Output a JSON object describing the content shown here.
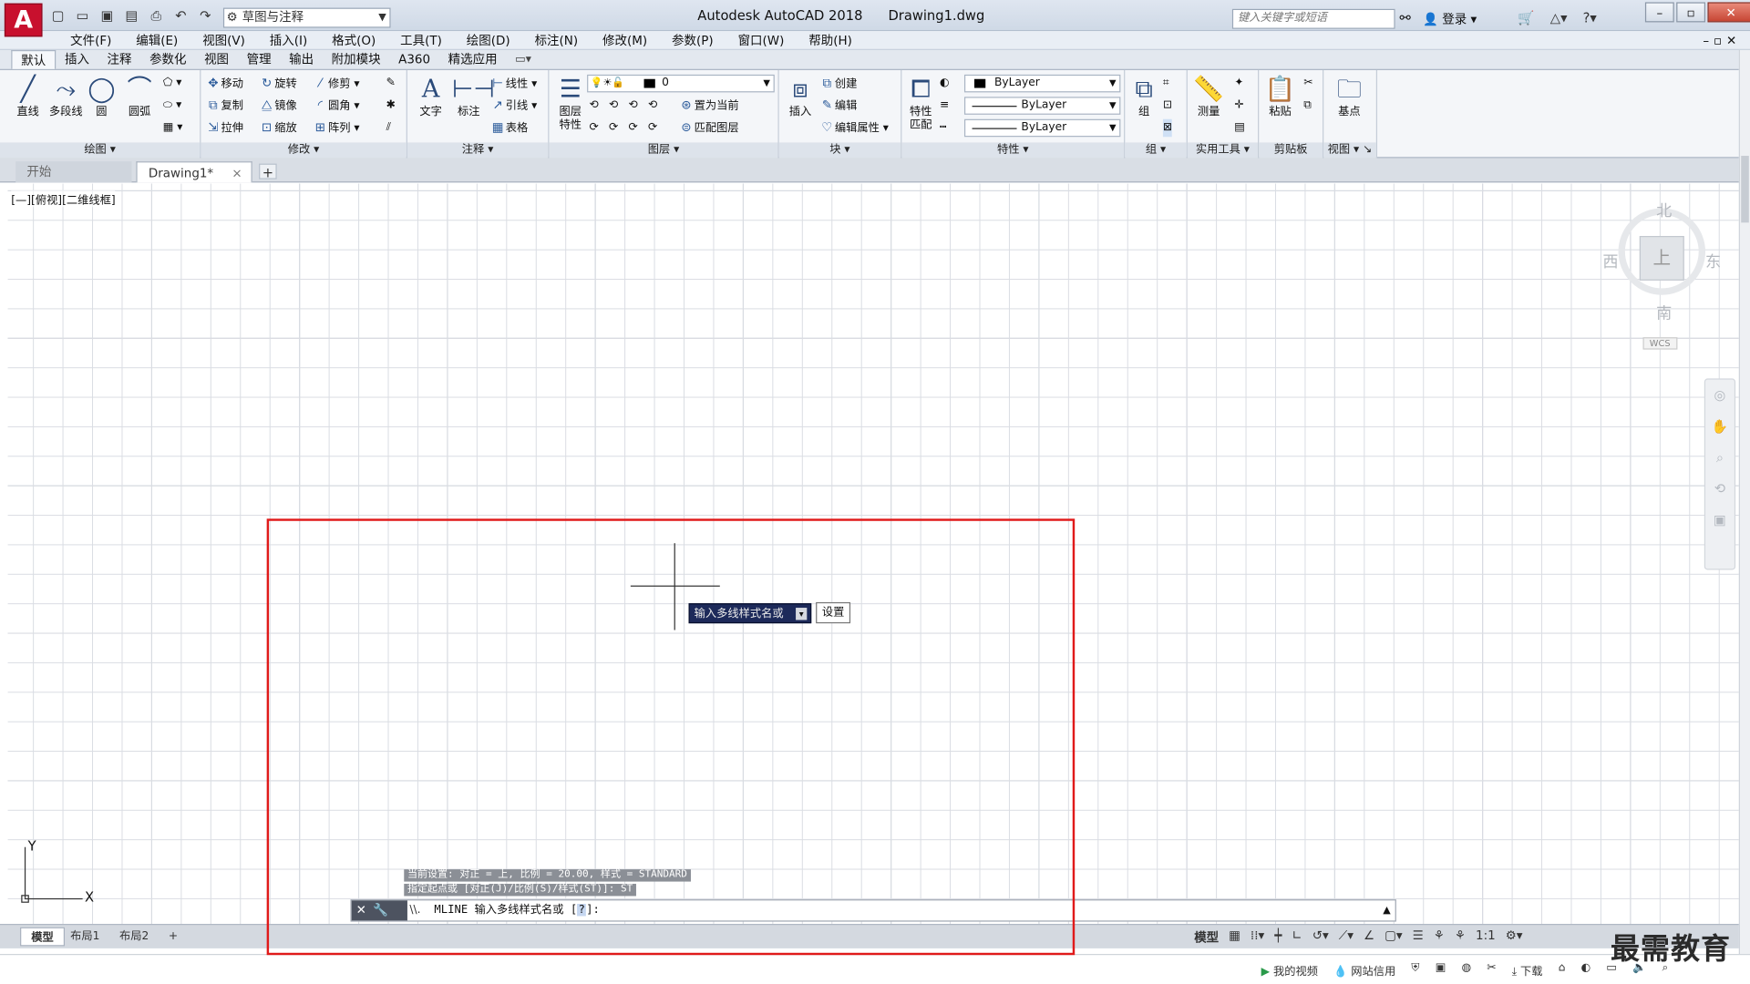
{
  "app": {
    "logo": "A",
    "title": "Autodesk AutoCAD 2018",
    "filename": "Drawing1.dwg",
    "workspace": "草图与注释",
    "search_placeholder": "键入关键字或短语",
    "login": "登录"
  },
  "quick_access": [
    "new-icon",
    "open-icon",
    "save-icon",
    "save-as-icon",
    "print-icon",
    "undo-icon",
    "redo-icon"
  ],
  "menu": [
    "文件(F)",
    "编辑(E)",
    "视图(V)",
    "插入(I)",
    "格式(O)",
    "工具(T)",
    "绘图(D)",
    "标注(N)",
    "修改(M)",
    "参数(P)",
    "窗口(W)",
    "帮助(H)"
  ],
  "ribbon_tabs": [
    "默认",
    "插入",
    "注释",
    "参数化",
    "视图",
    "管理",
    "输出",
    "附加模块",
    "A360",
    "精选应用"
  ],
  "ribbon": {
    "draw": {
      "title": "绘图",
      "line": "直线",
      "polyline": "多段线",
      "circle": "圆",
      "arc": "圆弧"
    },
    "modify": {
      "title": "修改",
      "move": "移动",
      "rotate": "旋转",
      "trim": "修剪",
      "copy": "复制",
      "mirror": "镜像",
      "fillet": "圆角",
      "stretch": "拉伸",
      "scale": "缩放",
      "array": "阵列"
    },
    "annotation": {
      "title": "注释",
      "text": "文字",
      "dimension": "标注",
      "linear": "线性",
      "leader": "引线",
      "table": "表格"
    },
    "layers": {
      "title": "图层",
      "properties": "图层\n特性",
      "layer_name": "0",
      "set_current": "置为当前",
      "match_layer": "匹配图层"
    },
    "block": {
      "title": "块",
      "insert": "插入",
      "create": "创建",
      "edit": "编辑",
      "edit_attributes": "编辑属性"
    },
    "properties": {
      "title": "特性",
      "match": "特性\n匹配",
      "color": "ByLayer",
      "linetype": "ByLayer",
      "lineweight": "ByLayer"
    },
    "groups": {
      "title": "组",
      "group": "组"
    },
    "utilities": {
      "title": "实用工具",
      "measure": "测量"
    },
    "clipboard": {
      "title": "剪贴板",
      "paste": "粘贴"
    },
    "view": {
      "title": "视图",
      "base": "基点"
    }
  },
  "file_tabs": {
    "start": "开始",
    "doc": "Drawing1*",
    "close": "×",
    "add": "+"
  },
  "viewport": {
    "label": "[—][俯视][二维线框]",
    "viewcube": {
      "north": "北",
      "south": "南",
      "east": "东",
      "west": "西",
      "face": "上",
      "wcs": "WCS"
    },
    "ucs": {
      "x": "X",
      "y": "Y"
    }
  },
  "dynamic_input": {
    "prompt": "输入多线样式名或",
    "option": "设置"
  },
  "command": {
    "history": [
      "当前设置: 对正 = 上, 比例 = 20.00, 样式 = STANDARD",
      "指定起点或 [对正(J)/比例(S)/样式(ST)]: ST"
    ],
    "prefix": "\\\\.",
    "prompt": "MLINE 输入多线样式名或 [",
    "option": "?",
    "suffix": "]:"
  },
  "layout_tabs": [
    "模型",
    "布局1",
    "布局2"
  ],
  "status": {
    "model": "模型",
    "scale": "1:1"
  },
  "taskbar": {
    "video": "我的视频",
    "credit": "网站信用",
    "download": "下载"
  },
  "watermark": "最需教育",
  "accent": {
    "highlight": "#e01a1a",
    "logo": "#c8102e",
    "prompt_bg": "#1d2a5a"
  }
}
